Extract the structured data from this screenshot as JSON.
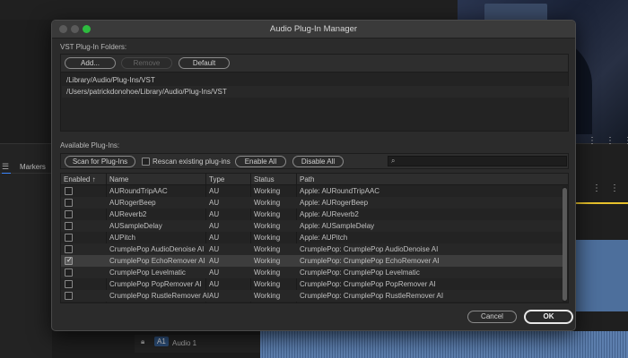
{
  "dialog": {
    "title": "Audio Plug-In Manager",
    "vst_section_label": "VST Plug-In Folders:",
    "vst_buttons": {
      "add": "Add...",
      "remove": "Remove",
      "default": "Default"
    },
    "vst_folders": [
      "/Library/Audio/Plug-Ins/VST",
      "/Users/patrickdonohoe/Library/Audio/Plug-Ins/VST"
    ],
    "available_label": "Available Plug-Ins:",
    "toolbar": {
      "scan": "Scan for Plug-Ins",
      "rescan": "Rescan existing plug-ins",
      "enable_all": "Enable All",
      "disable_all": "Disable All",
      "search_placeholder": ""
    },
    "columns": {
      "enabled": "Enabled",
      "sort_arrow": "↑",
      "name": "Name",
      "type": "Type",
      "status": "Status",
      "path": "Path"
    },
    "plugins": [
      {
        "enabled": false,
        "name": "AURoundTripAAC",
        "type": "AU",
        "status": "Working",
        "path": "Apple: AURoundTripAAC"
      },
      {
        "enabled": false,
        "name": "AURogerBeep",
        "type": "AU",
        "status": "Working",
        "path": "Apple: AURogerBeep"
      },
      {
        "enabled": false,
        "name": "AUReverb2",
        "type": "AU",
        "status": "Working",
        "path": "Apple: AUReverb2"
      },
      {
        "enabled": false,
        "name": "AUSampleDelay",
        "type": "AU",
        "status": "Working",
        "path": "Apple: AUSampleDelay"
      },
      {
        "enabled": false,
        "name": "AUPitch",
        "type": "AU",
        "status": "Working",
        "path": "Apple: AUPitch"
      },
      {
        "enabled": false,
        "name": "CrumplePop AudioDenoise AI",
        "type": "AU",
        "status": "Working",
        "path": "CrumplePop: CrumplePop AudioDenoise AI"
      },
      {
        "enabled": true,
        "name": "CrumplePop EchoRemover AI",
        "type": "AU",
        "status": "Working",
        "path": "CrumplePop: CrumplePop EchoRemover AI"
      },
      {
        "enabled": false,
        "name": "CrumplePop Levelmatic",
        "type": "AU",
        "status": "Working",
        "path": "CrumplePop: CrumplePop Levelmatic"
      },
      {
        "enabled": false,
        "name": "CrumplePop PopRemover AI",
        "type": "AU",
        "status": "Working",
        "path": "CrumplePop: CrumplePop PopRemover AI"
      },
      {
        "enabled": false,
        "name": "CrumplePop RustleRemover AI",
        "type": "AU",
        "status": "Working",
        "path": "CrumplePop: CrumplePop RustleRemover AI"
      }
    ],
    "selected_index": 6,
    "buttons": {
      "cancel": "Cancel",
      "ok": "OK"
    }
  },
  "background": {
    "markers_tab": "Markers",
    "track_label": "A1",
    "track_name": "Audio 1"
  }
}
